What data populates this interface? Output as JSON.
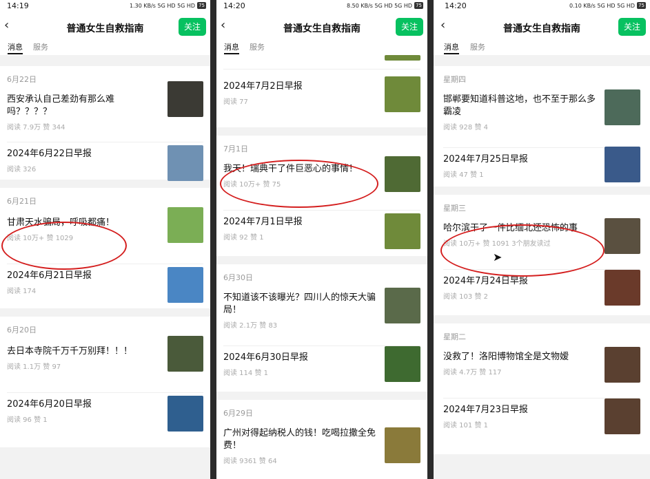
{
  "header": {
    "title": "普通女生自救指南",
    "follow_label": "关注",
    "back_glyph": "‹"
  },
  "tabs": {
    "messages": "消息",
    "services": "服务"
  },
  "panels": [
    {
      "status_time": "14:19",
      "status_icons": "1.30 KB/s 5G HD 5G HD",
      "battery": "75",
      "sections": [
        {
          "date": "6月22日",
          "articles": [
            {
              "title": "西安承认自己差劲有那么难吗？？？？",
              "meta": "阅读 7.9万  赞 344",
              "thumb": "#3b3a34"
            },
            {
              "title": "2024年6月22日早报",
              "meta": "阅读 326",
              "thumb": "#6f91b3"
            }
          ]
        },
        {
          "date": "6月21日",
          "articles": [
            {
              "title": "甘肃天水骗局，呼吸都痛！",
              "meta": "阅读 10万+  赞 1029",
              "thumb": "#7bae55"
            },
            {
              "title": "2024年6月21日早报",
              "meta": "阅读 174",
              "thumb": "#4a86c4"
            }
          ]
        },
        {
          "date": "6月20日",
          "articles": [
            {
              "title": "去日本寺院千万千万别拜！！！",
              "meta": "阅读 1.1万  赞 97",
              "thumb": "#4a5a3a"
            },
            {
              "title": "2024年6月20日早报",
              "meta": "阅读 96  赞 1",
              "thumb": "#2f5f8f"
            }
          ]
        }
      ]
    },
    {
      "status_time": "14:20",
      "status_icons": "8.50 KB/s 5G HD 5G HD",
      "battery": "75",
      "sections": [
        {
          "date": "",
          "articles": [
            {
              "title": "2024年7月2日早报",
              "meta": "阅读 77",
              "thumb": "#6f8a3a"
            }
          ]
        },
        {
          "date": "7月1日",
          "articles": [
            {
              "title": "我天！瑞典干了件巨恶心的事情！",
              "meta": "阅读 10万+  赞 75",
              "thumb": "#4f6a34"
            },
            {
              "title": "2024年7月1日早报",
              "meta": "阅读 92  赞 1",
              "thumb": "#6f8a3a"
            }
          ]
        },
        {
          "date": "6月30日",
          "articles": [
            {
              "title": "不知道该不该曝光？四川人的惊天大骗局！",
              "meta": "阅读 2.1万  赞 83",
              "thumb": "#5a6a4a"
            },
            {
              "title": "2024年6月30日早报",
              "meta": "阅读 114  赞 1",
              "thumb": "#3e6a30"
            }
          ]
        },
        {
          "date": "6月29日",
          "articles": [
            {
              "title": "广州对得起纳税人的钱！吃喝拉撒全免费！",
              "meta": "阅读 9361  赞 64",
              "thumb": "#8a7a3a"
            }
          ]
        }
      ]
    },
    {
      "status_time": "14:20",
      "status_icons": "0.10 KB/s 5G HD 5G HD",
      "battery": "75",
      "sections": [
        {
          "date": "星期四",
          "articles": [
            {
              "title": "邯郸要知道科普这地，也不至于那么多霸凌",
              "meta": "阅读 928  赞 4",
              "thumb": "#4d6a5a"
            },
            {
              "title": "2024年7月25日早报",
              "meta": "阅读 47  赞 1",
              "thumb": "#3a5a8a"
            }
          ]
        },
        {
          "date": "星期三",
          "articles": [
            {
              "title": "哈尔滨干了一件比缅北还恐怖的事",
              "meta": "阅读 10万+  赞 1091  3个朋友读过",
              "thumb": "#5a5040"
            },
            {
              "title": "2024年7月24日早报",
              "meta": "阅读 103  赞 2",
              "thumb": "#6a3a2a"
            }
          ]
        },
        {
          "date": "星期二",
          "articles": [
            {
              "title": "没救了！洛阳博物馆全是文物嫒",
              "meta": "阅读 4.7万  赞 117",
              "thumb": "#5a4030"
            },
            {
              "title": "2024年7月23日早报",
              "meta": "阅读 101  赞 1",
              "thumb": "#5a4030"
            }
          ]
        }
      ]
    }
  ]
}
